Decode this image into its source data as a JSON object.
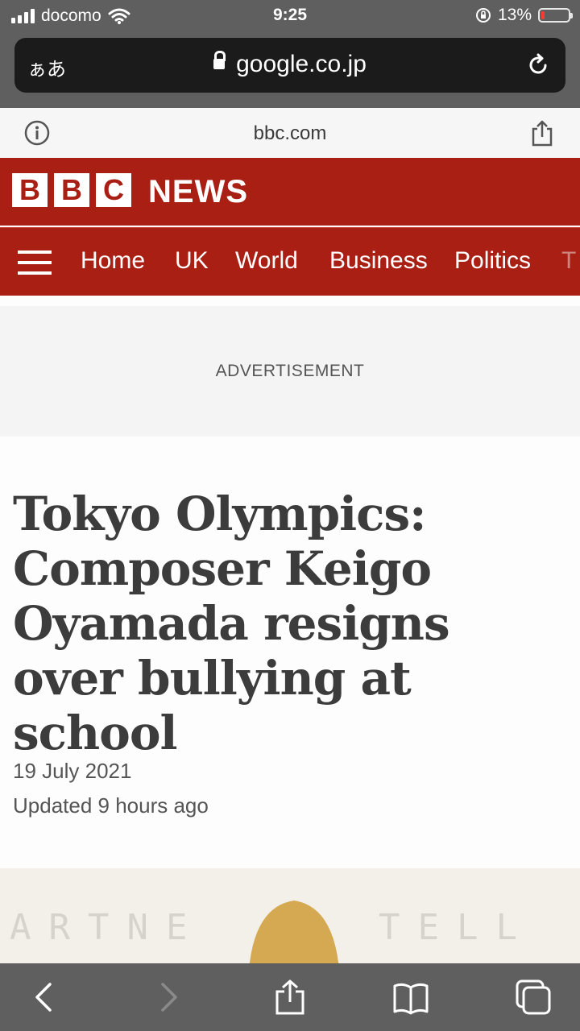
{
  "status_bar": {
    "carrier": "docomo",
    "time": "9:25",
    "battery_percent": "13%",
    "battery_level": 0.13
  },
  "safari": {
    "text_size_label": "ぁあ",
    "url": "google.co.jp"
  },
  "site_bar": {
    "domain": "bbc.com"
  },
  "bbc": {
    "logo_letters": [
      "B",
      "B",
      "C"
    ],
    "section_title": "NEWS",
    "nav": [
      "Home",
      "UK",
      "World",
      "Business",
      "Politics",
      "T"
    ],
    "brand_color": "#a91f14"
  },
  "ad": {
    "label": "ADVERTISEMENT"
  },
  "article": {
    "headline": "Tokyo Olympics: Composer Keigo Oyamada resigns over bullying at school",
    "date": "19 July 2021",
    "updated": "Updated 9 hours ago"
  },
  "hero": {
    "backdrop_text_left": "ARTNE",
    "backdrop_text_right": "TELL"
  },
  "toolbar": {
    "icons": [
      "back-icon",
      "forward-icon",
      "share-icon",
      "bookmarks-icon",
      "tabs-icon"
    ]
  }
}
